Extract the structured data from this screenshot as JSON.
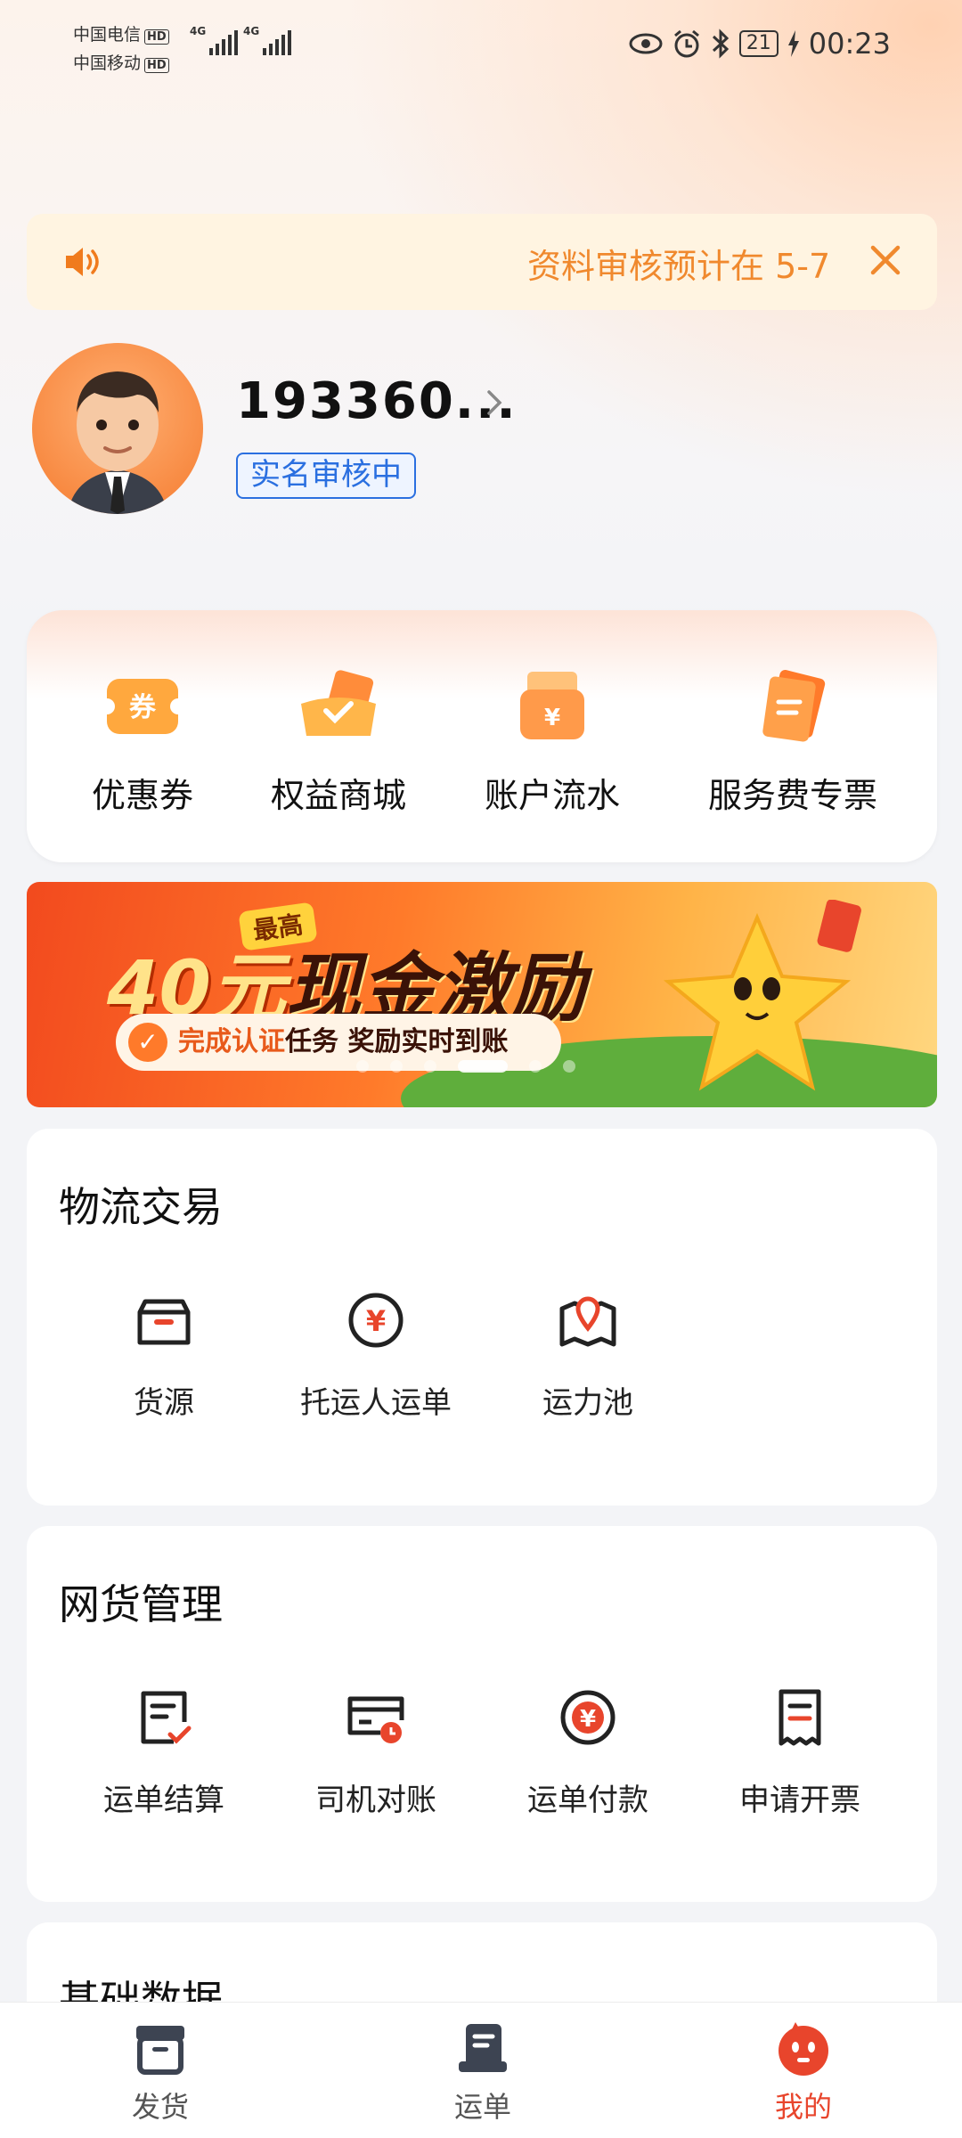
{
  "status_bar": {
    "carrier1": "中国电信",
    "carrier2": "中国移动",
    "hd": "HD",
    "network": "4G",
    "battery": "21",
    "time": "00:23"
  },
  "notice": {
    "text": "资料审核预计在 5-7"
  },
  "profile": {
    "username": "193360...",
    "verify_status": "实名审核中"
  },
  "quick_actions": [
    {
      "label": "优惠券",
      "icon": "coupon-icon"
    },
    {
      "label": "权益商城",
      "icon": "rights-mall-icon"
    },
    {
      "label": "账户流水",
      "icon": "account-flow-icon"
    },
    {
      "label": "服务费专票",
      "icon": "service-invoice-icon"
    }
  ],
  "banner": {
    "tag": "最高",
    "amount": "40元",
    "headline": "现金激励",
    "pill_highlight": "完成认证",
    "pill_rest": "任务 奖励实时到账"
  },
  "logistics": {
    "title": "物流交易",
    "items": [
      {
        "label": "货源",
        "icon": "cargo-box-icon"
      },
      {
        "label": "托运人运单",
        "icon": "yuan-circle-icon"
      },
      {
        "label": "运力池",
        "icon": "map-pin-icon"
      }
    ]
  },
  "network_freight": {
    "title": "网货管理",
    "items": [
      {
        "label": "运单结算",
        "icon": "settlement-doc-icon"
      },
      {
        "label": "司机对账",
        "icon": "reconcile-card-icon"
      },
      {
        "label": "运单付款",
        "icon": "payment-yuan-icon"
      },
      {
        "label": "申请开票",
        "icon": "invoice-receipt-icon"
      }
    ]
  },
  "base_data": {
    "title": "基础数据"
  },
  "bottom_nav": {
    "items": [
      {
        "label": "发货",
        "icon": "ship-box-icon"
      },
      {
        "label": "运单",
        "icon": "waybill-icon"
      },
      {
        "label": "我的",
        "icon": "mine-mascot-icon"
      }
    ],
    "active": "我的"
  },
  "colors": {
    "accent": "#e8452c",
    "notice_text": "#f0892e",
    "verify_blue": "#2a6fe0"
  }
}
